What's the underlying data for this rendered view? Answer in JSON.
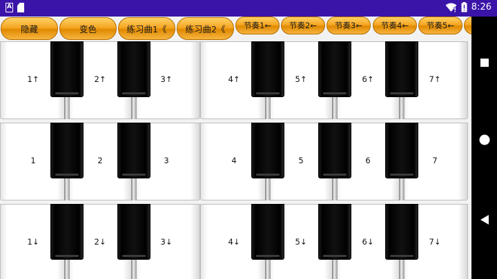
{
  "status_bar": {
    "time": "8:26",
    "icons": [
      "notification-a-icon",
      "sd-card-icon",
      "wifi-icon",
      "battery-icon"
    ],
    "background": "#3a14a8"
  },
  "toolbar": {
    "buttons": [
      {
        "label": "隐藏"
      },
      {
        "label": "变色"
      },
      {
        "label": "练习曲1《"
      },
      {
        "label": "练习曲2《"
      },
      {
        "label": "节奏1←"
      },
      {
        "label": "节奏2←"
      },
      {
        "label": "节奏3←"
      },
      {
        "label": "节奏4←"
      },
      {
        "label": "节奏5←"
      }
    ],
    "accent": "#f5a623"
  },
  "piano": {
    "rows": [
      {
        "keys": [
          "1↑",
          "2↑",
          "3↑",
          "4↑",
          "5↑",
          "6↑",
          "7↑"
        ]
      },
      {
        "keys": [
          "1",
          "2",
          "3",
          "4",
          "5",
          "6",
          "7"
        ]
      },
      {
        "keys": [
          "1↓",
          "2↓",
          "3↓",
          "4↓",
          "5↓",
          "6↓",
          "7↓"
        ]
      }
    ]
  },
  "nav_bar": {
    "icons": [
      "back-triangle-icon",
      "home-circle-icon",
      "recents-square-icon"
    ]
  }
}
